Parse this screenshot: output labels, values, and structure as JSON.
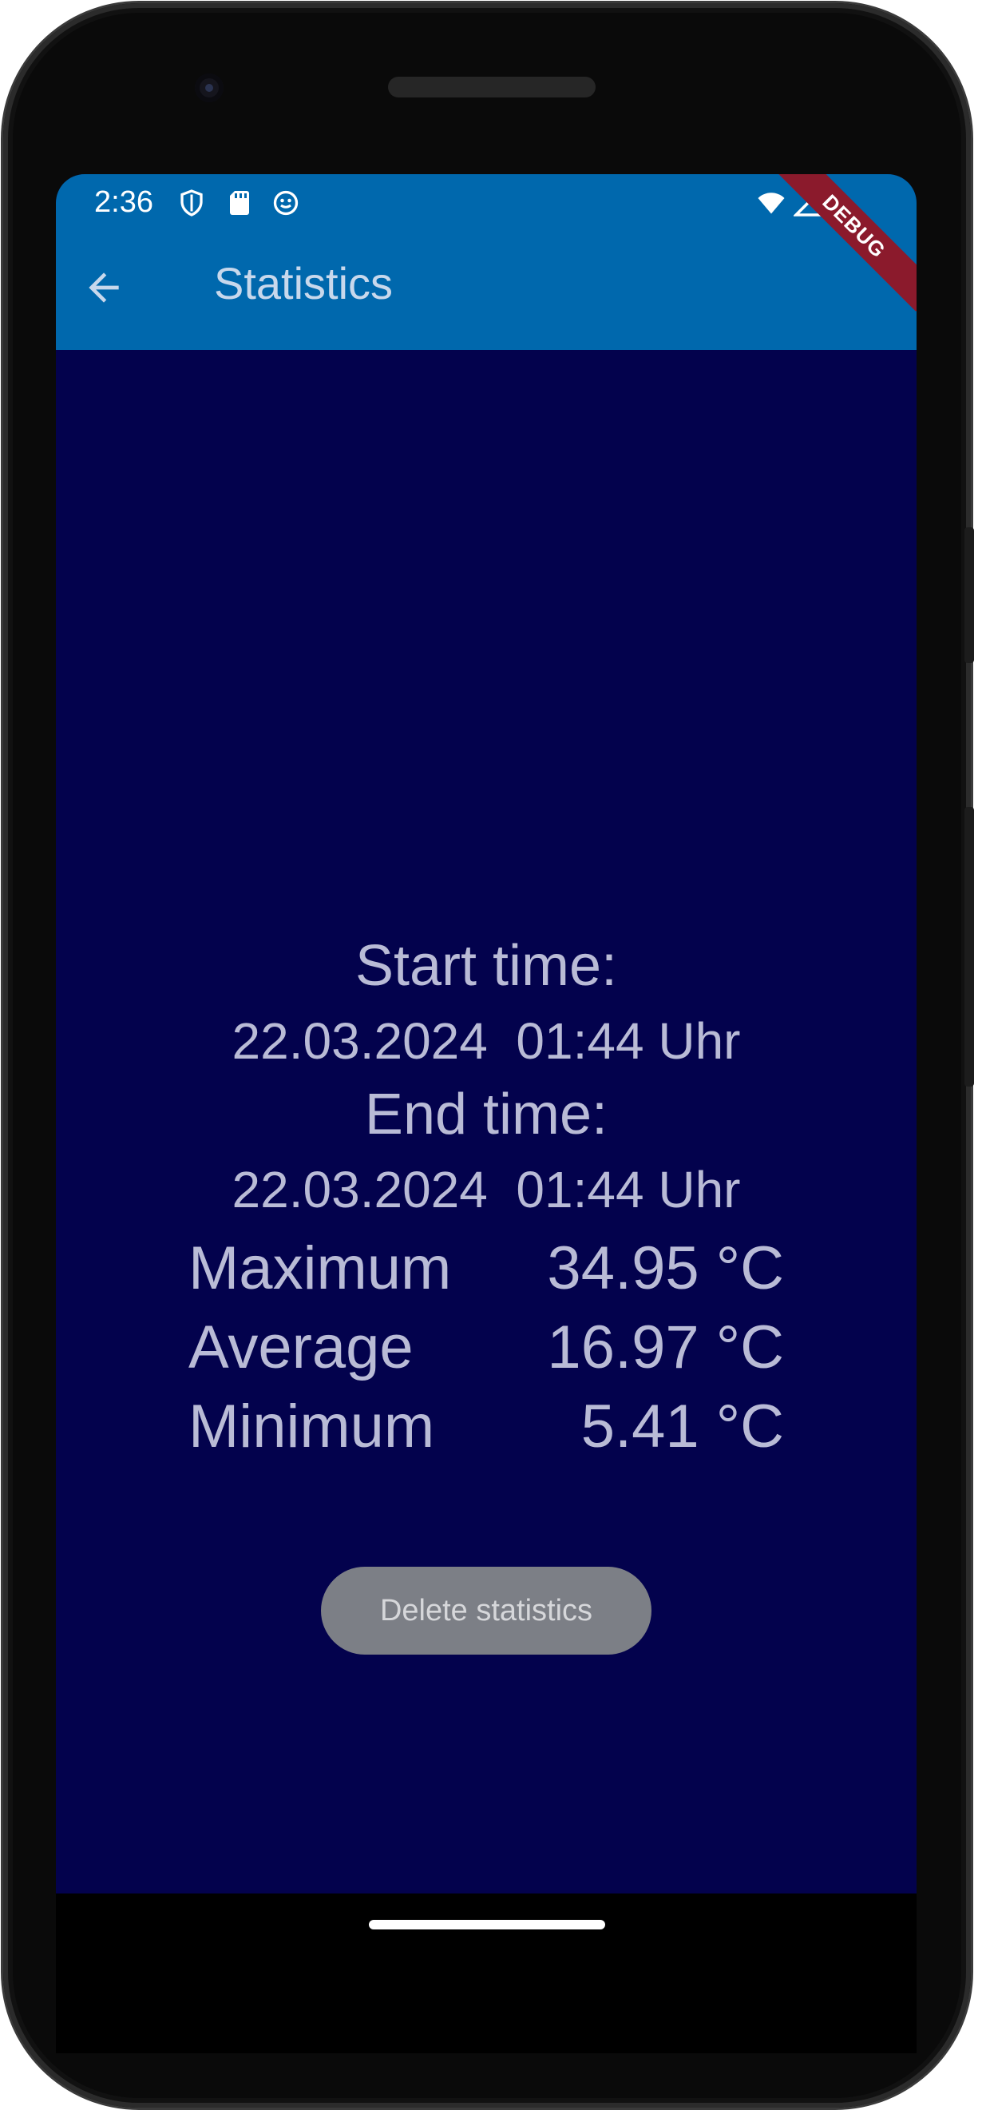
{
  "status_bar": {
    "time": "2:36",
    "left_icons": [
      "shield-icon",
      "sd-card-icon",
      "smiley-icon"
    ],
    "right_icons": [
      "wifi-icon",
      "signal-icon"
    ]
  },
  "app_bar": {
    "title": "Statistics",
    "background_color": "#0068ad",
    "debug_banner": "DEBUG"
  },
  "statistics": {
    "start_time_label": "Start time:",
    "start_time_value": "22.03.2024  01:44 Uhr",
    "end_time_label": "End time:",
    "end_time_value": "22.03.2024  01:44 Uhr",
    "rows": [
      {
        "name": "Maximum",
        "value": "34.95 °C"
      },
      {
        "name": "Average",
        "value": "16.97 °C"
      },
      {
        "name": "Minimum",
        "value": "5.41 °C"
      }
    ]
  },
  "actions": {
    "delete_label": "Delete statistics"
  },
  "colors": {
    "screen_background": "#03024d",
    "text": "#b9bbd6",
    "button_background": "#7c7f86"
  }
}
